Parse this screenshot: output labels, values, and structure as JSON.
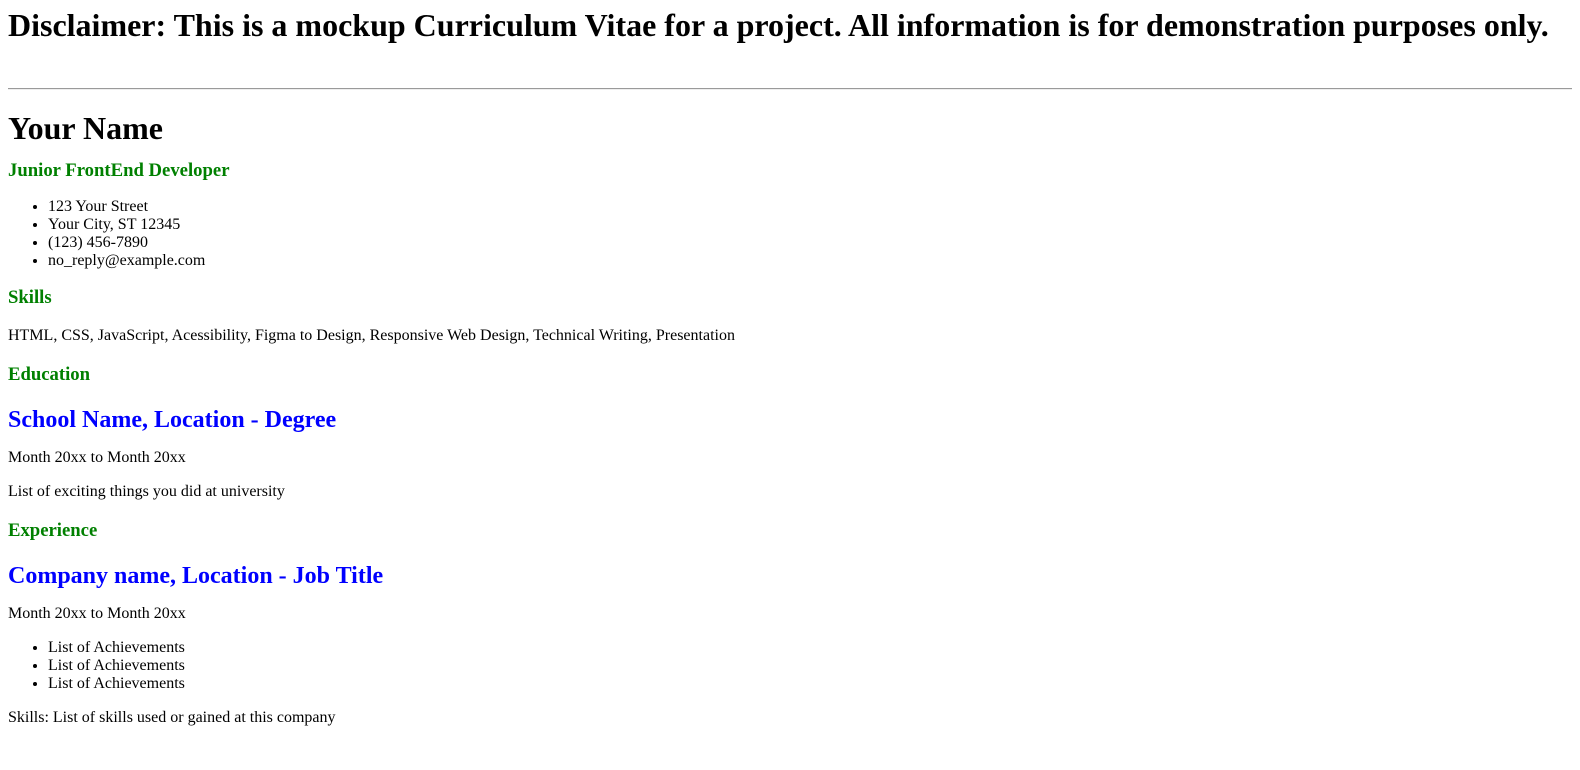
{
  "disclaimer": "Disclaimer: This is a mockup Curriculum Vitae for a project. All information is for demonstration purposes only.",
  "name": "Your Name",
  "role": "Junior FrontEnd Developer",
  "contact": [
    "123 Your Street",
    "Your City, ST 12345",
    "(123) 456-7890",
    "no_reply@example.com"
  ],
  "skills": {
    "title": "Skills",
    "text": "HTML, CSS, JavaScript, Acessibility, Figma to Design, Responsive Web Design, Technical Writing, Presentation"
  },
  "education": {
    "title": "Education",
    "entry_title": "School Name, Location - Degree",
    "dates": "Month 20xx to Month 20xx",
    "description": "List of exciting things you did at university"
  },
  "experience": {
    "title": "Experience",
    "entry_title": "Company name, Location - Job Title",
    "dates": "Month 20xx to Month 20xx",
    "achievements": [
      "List of Achievements",
      "List of Achievements",
      "List of Achievements"
    ],
    "skills_note": "Skills: List of skills used or gained at this company"
  },
  "colors": {
    "section_heading": "#008000",
    "entry_heading": "#0000ff"
  }
}
